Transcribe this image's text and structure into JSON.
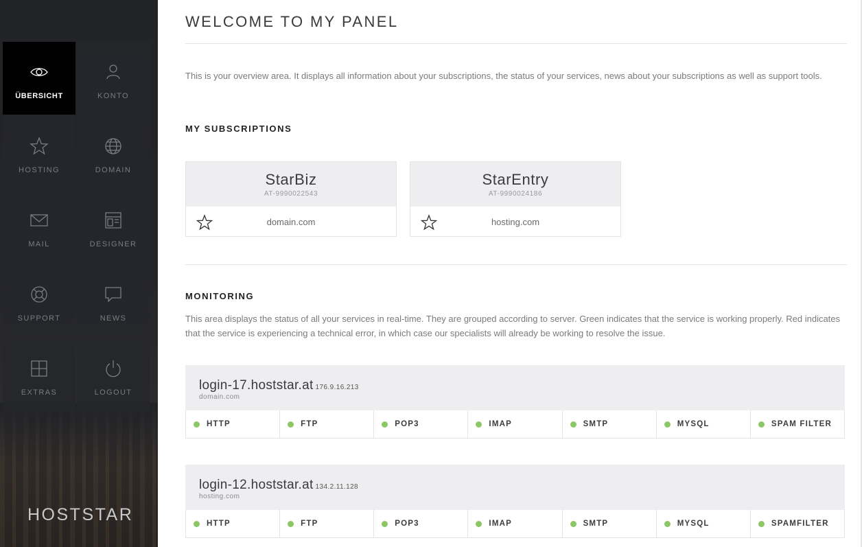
{
  "colors": {
    "status_ok": "#8cc766",
    "sidebar_bg": "#222327",
    "active_tile": "#000000"
  },
  "sidebar": {
    "brand": "HOSTSTAR",
    "items": [
      {
        "label": "ÜBERSICHT",
        "icon": "eye-icon"
      },
      {
        "label": "KONTO",
        "icon": "user-icon"
      },
      {
        "label": "HOSTING",
        "icon": "star-icon"
      },
      {
        "label": "DOMAIN",
        "icon": "globe-icon"
      },
      {
        "label": "MAIL",
        "icon": "envelope-icon"
      },
      {
        "label": "DESIGNER",
        "icon": "layout-icon"
      },
      {
        "label": "SUPPORT",
        "icon": "lifebuoy-icon"
      },
      {
        "label": "NEWS",
        "icon": "speech-bubble-icon"
      },
      {
        "label": "EXTRAS",
        "icon": "plus-box-icon"
      },
      {
        "label": "LOGOUT",
        "icon": "power-icon"
      }
    ]
  },
  "main": {
    "title": "WELCOME TO MY PANEL",
    "intro": "This is your overview area. It displays all information about your subscriptions, the status of your services, news about your subscriptions as well as support tools.",
    "subscriptions": {
      "heading": "MY SUBSCRIPTIONS",
      "cards": [
        {
          "name": "StarBiz",
          "id": "AT-9990022543",
          "domain": "domain.com",
          "icon": "star-outline-icon"
        },
        {
          "name": "StarEntry",
          "id": "AT-9990024186",
          "domain": "hosting.com",
          "icon": "star-outline-icon"
        }
      ]
    },
    "monitoring": {
      "heading": "MONITORING",
      "text": "This area displays the status of all your services in real-time. They are grouped according to server. Green indicates that the service is working properly. Red indicates that the service is experiencing a technical error, in which case our specialists will already be working to resolve the issue.",
      "servers": [
        {
          "host": "login-17.hoststar.at",
          "ip": "176.9.16.213",
          "domain": "domain.com",
          "services": [
            "HTTP",
            "FTP",
            "POP3",
            "IMAP",
            "SMTP",
            "MYSQL",
            "SPAM FILTER"
          ]
        },
        {
          "host": "login-12.hoststar.at",
          "ip": "134.2.11.128",
          "domain": "hosting.com",
          "services": [
            "HTTP",
            "FTP",
            "POP3",
            "IMAP",
            "SMTP",
            "MYSQL",
            "SPAMFILTER"
          ]
        }
      ]
    }
  }
}
